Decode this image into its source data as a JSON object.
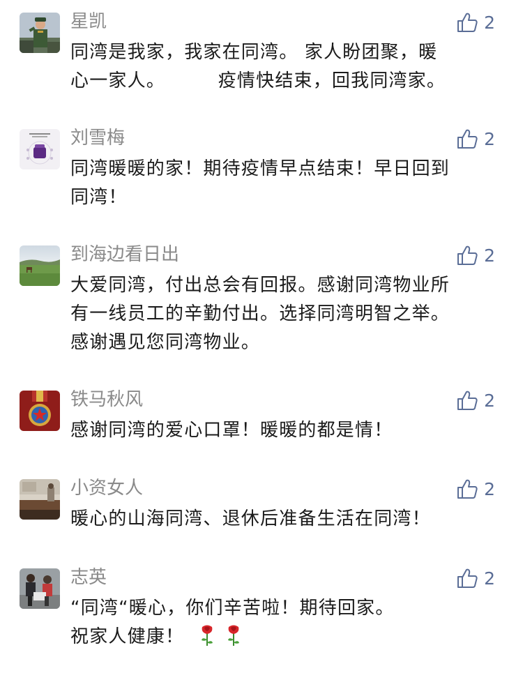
{
  "comments": [
    {
      "name": "星凯",
      "likes": "2",
      "avatar_icon": "soldier-avatar-icon",
      "lines": [
        "同湾是我家，我家在同湾。 家人盼团聚，暖",
        "心一家人。        疫情快结束，回我同湾家。"
      ]
    },
    {
      "name": "刘雪梅",
      "likes": "2",
      "avatar_icon": "product-poster-avatar-icon",
      "lines": [
        "同湾暖暖的家！期待疫情早点结束！早日回到",
        "同湾！"
      ]
    },
    {
      "name": "到海边看日出",
      "likes": "2",
      "avatar_icon": "grassland-horse-avatar-icon",
      "lines": [
        "大爱同湾，付出总会有回报。感谢同湾物业所",
        "有一线员工的辛勤付出。选择同湾明智之举。",
        "感谢遇见您同湾物业。"
      ]
    },
    {
      "name": "铁马秋风",
      "likes": "2",
      "avatar_icon": "medal-avatar-icon",
      "lines": [
        "感谢同湾的爱心口罩！暖暖的都是情！"
      ]
    },
    {
      "name": "小资女人",
      "likes": "2",
      "avatar_icon": "room-scene-avatar-icon",
      "lines": [
        "暖心的山海同湾、退休后准备生活在同湾！"
      ]
    },
    {
      "name": "志英",
      "likes": "2",
      "avatar_icon": "family-photo-avatar-icon",
      "lines": [
        "“同湾“暖心，你们辛苦啦！期待回家。",
        "祝家人健康！"
      ]
    }
  ],
  "colors": {
    "name": "#8a8a8a",
    "text": "#1b1b1b",
    "like": "#5a6d96",
    "background": "#ffffff"
  },
  "icons": {
    "like": "thumbs-up-icon",
    "emoji": "rose-icon"
  }
}
